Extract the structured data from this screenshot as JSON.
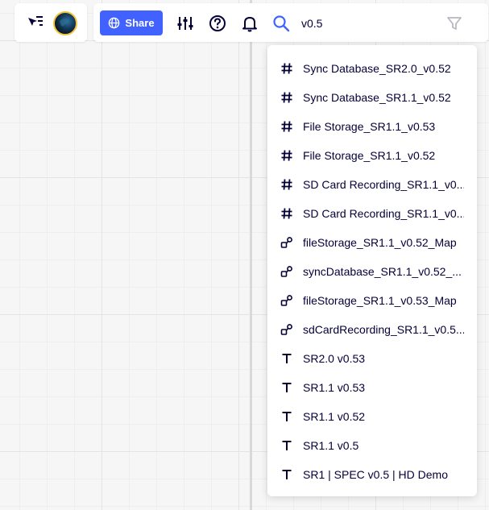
{
  "toolbar_left": {
    "cursor_icon": "cursor-list-icon",
    "avatar_icon": "earth-avatar"
  },
  "toolbar_right": {
    "share_label": "Share",
    "share_icon": "globe-icon",
    "settings_icon": "sliders-icon",
    "help_icon": "question-circle-icon",
    "notifications_icon": "bell-icon",
    "search_icon": "search-icon",
    "search_value": "v0.5",
    "filter_icon": "filter-icon"
  },
  "colors": {
    "accent": "#4262ff",
    "text": "#050038",
    "avatar_ring": "#f0c43a"
  },
  "results": [
    {
      "icon": "hash-icon",
      "label": "Sync Database_SR2.0_v0.52"
    },
    {
      "icon": "hash-icon",
      "label": "Sync Database_SR1.1_v0.52"
    },
    {
      "icon": "hash-icon",
      "label": "File Storage_SR1.1_v0.53"
    },
    {
      "icon": "hash-icon",
      "label": "File Storage_SR1.1_v0.52"
    },
    {
      "icon": "hash-icon",
      "label": "SD Card Recording_SR1.1_v0..."
    },
    {
      "icon": "hash-icon",
      "label": "SD Card Recording_SR1.1_v0..."
    },
    {
      "icon": "mindmap-icon",
      "label": "fileStorage_SR1.1_v0.52_Map"
    },
    {
      "icon": "mindmap-icon",
      "label": "syncDatabase_SR1.1_v0.52_..."
    },
    {
      "icon": "mindmap-icon",
      "label": "fileStorage_SR1.1_v0.53_Map"
    },
    {
      "icon": "mindmap-icon",
      "label": "sdCardRecording_SR1.1_v0.5..."
    },
    {
      "icon": "text-icon",
      "label": "SR2.0 v0.53"
    },
    {
      "icon": "text-icon",
      "label": "SR1.1 v0.53"
    },
    {
      "icon": "text-icon",
      "label": "SR1.1 v0.52"
    },
    {
      "icon": "text-icon",
      "label": "SR1.1 v0.5"
    },
    {
      "icon": "text-icon",
      "label": "SR1 | SPEC v0.5 | HD Demo"
    }
  ]
}
